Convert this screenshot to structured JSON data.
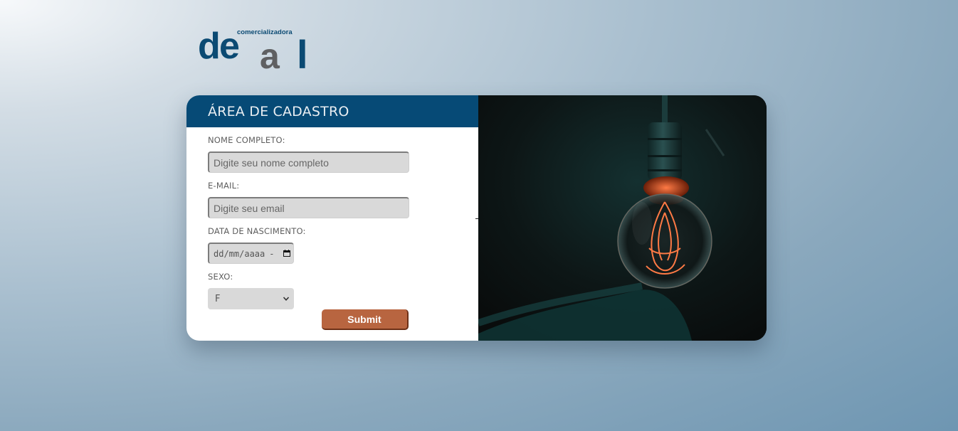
{
  "logo": {
    "tagline": "comercializadora",
    "wordmark_d": "d",
    "wordmark_e": "e",
    "wordmark_a": "a",
    "wordmark_l": "l",
    "colors": {
      "blue": "#0b4a73",
      "gray": "#5f6062"
    }
  },
  "form": {
    "title": "ÁREA DE CADASTRO",
    "fields": {
      "name": {
        "label": "NOME COMPLETO:",
        "placeholder": "Digite seu nome completo",
        "value": ""
      },
      "email": {
        "label": "E-MAIL:",
        "placeholder": "Digite seu email",
        "value": ""
      },
      "birthdate": {
        "label": "DATA DE NASCIMENTO:",
        "display": "dd/mm/aaaa",
        "icon": "calendar-icon"
      },
      "sex": {
        "label": "SEXO:",
        "selected": "F",
        "icon": "chevron-down-icon"
      }
    },
    "submit_label": "Submit"
  },
  "colors": {
    "header_bg": "#064a76",
    "button_bg": "#b86540",
    "input_bg": "#d9d9d9",
    "bulb_glow": "#e8603a"
  }
}
